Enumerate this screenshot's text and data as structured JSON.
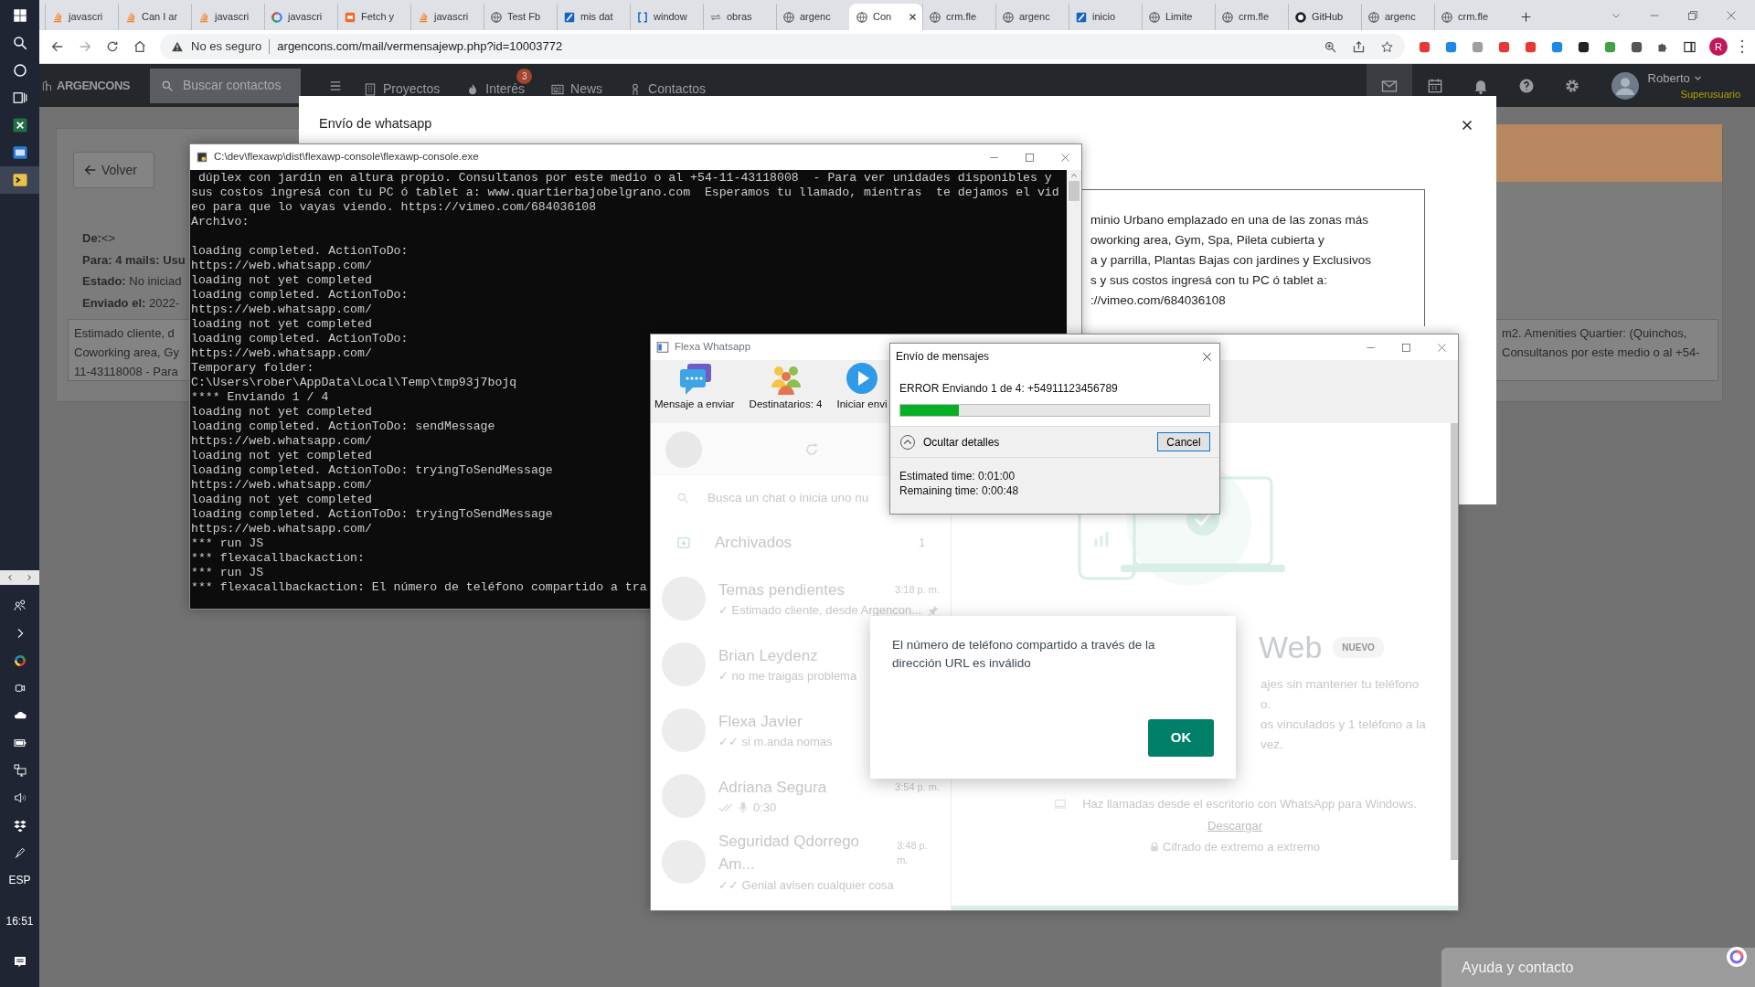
{
  "taskbar": {
    "apps": [
      {
        "kind": "sheet",
        "selected": false
      },
      {
        "kind": "app",
        "selected": false
      },
      {
        "kind": "terminal",
        "selected": true
      }
    ],
    "language": "ESP",
    "clock": "16:51"
  },
  "browser": {
    "tabs": [
      {
        "kind": "stack",
        "label": "javascri",
        "selected": false
      },
      {
        "kind": "stack",
        "label": "Can I ar",
        "selected": false
      },
      {
        "kind": "stack",
        "label": "javascri",
        "selected": false
      },
      {
        "kind": "ring",
        "label": "javascri",
        "selected": false
      },
      {
        "kind": "square",
        "label": "Fetch y",
        "selected": false
      },
      {
        "kind": "stack",
        "label": "javascri",
        "selected": false
      },
      {
        "kind": "globe",
        "label": "Test Fb",
        "selected": false
      },
      {
        "kind": "tile",
        "label": "mis dat",
        "selected": false
      },
      {
        "kind": "bracket",
        "label": "window",
        "selected": false
      },
      {
        "kind": "arrows",
        "label": "obras",
        "selected": false
      },
      {
        "kind": "globe",
        "label": "argenc",
        "selected": false
      },
      {
        "kind": "globe",
        "label": "Con",
        "selected": true
      },
      {
        "kind": "globe",
        "label": "crm.fle",
        "selected": false
      },
      {
        "kind": "globe",
        "label": "argenc",
        "selected": false
      },
      {
        "kind": "tile",
        "label": "inicio",
        "selected": false
      },
      {
        "kind": "globe",
        "label": "Limite",
        "selected": false
      },
      {
        "kind": "globe",
        "label": "crm.fle",
        "selected": false
      },
      {
        "kind": "cat",
        "label": "GitHub",
        "selected": false
      },
      {
        "kind": "globe",
        "label": "argenc",
        "selected": false
      },
      {
        "kind": "globe",
        "label": "crm.fle",
        "selected": false
      }
    ],
    "address": {
      "security": "No es seguro",
      "url": "argencons.com/mail/vermensajewp.php?id=10003772"
    },
    "profile": "R"
  },
  "site": {
    "logo": "ARGENCONS",
    "search_placeholder": "Buscar contactos",
    "nav": [
      {
        "kind": "building",
        "label": "Proyectos"
      },
      {
        "kind": "flame",
        "label": "Interés",
        "badge": "3"
      },
      {
        "kind": "news",
        "label": "News"
      },
      {
        "kind": "person",
        "label": "Contactos"
      }
    ],
    "tools": [
      {
        "kind": "mail",
        "selected": true
      },
      {
        "kind": "calendar",
        "selected": false
      },
      {
        "kind": "bell",
        "selected": false
      },
      {
        "kind": "help",
        "selected": false
      },
      {
        "kind": "gear",
        "selected": false
      }
    ],
    "user": {
      "name": "Roberto",
      "role": "Superusuario"
    }
  },
  "page": {
    "back_button": "Volver",
    "fields": [
      {
        "label": "De:",
        "value": "<>"
      },
      {
        "label": "Para: 4 mails: Usu"
      },
      {
        "label": "Estado:",
        "value": "No iniciad"
      },
      {
        "label": "Enviado el:",
        "value": "2022-"
      }
    ],
    "message": {
      "left": [
        "Estimado cliente, d",
        "Coworking area, Gy",
        "11-43118008 - Para"
      ],
      "right": [
        "m2. Amenities Quartier: (Quinchos,",
        "Consultanos por este medio o al +54-"
      ]
    }
  },
  "modal": {
    "title": "Envío de whatsapp",
    "message": [
      "minio Urbano emplazado en una de las zonas más",
      "oworking area, Gym, Spa, Pileta cubierta y",
      "a y parrilla, Plantas Bajas con jardines y Exclusivos",
      "s y sus costos ingresá con tu PC ó tablet a:",
      "://vimeo.com/684036108"
    ]
  },
  "console": {
    "title": "C:\\dev\\flexawp\\dist\\flexawp-console\\flexawp-console.exe",
    "blocks": [
      [
        " dúplex con jardín en altura propio. Consultanos por este medio o al +54-11-43118008  - Para ver unidades disponibles y",
        "sus costos ingresá con tu PC ó tablet a: www.quartierbajobelgrano.com  Esperamos tu llamado, mientras  te dejamos el vid",
        "eo para que lo vayas viendo. https://vimeo.com/684036108",
        "Archivo:"
      ],
      [
        "loading completed. ActionToDo:",
        "https://web.whatsapp.com/",
        "loading not yet completed",
        "loading completed. ActionToDo:",
        "https://web.whatsapp.com/",
        "loading not yet completed",
        "loading completed. ActionToDo:",
        "https://web.whatsapp.com/",
        "Temporary folder:",
        "C:\\Users\\rober\\AppData\\Local\\Temp\\tmp93j7bojq",
        "**** Enviando 1 / 4",
        "loading not yet completed",
        "loading completed. ActionToDo: sendMessage",
        "https://web.whatsapp.com/",
        "loading not yet completed",
        "loading completed. ActionToDo: tryingToSendMessage",
        "https://web.whatsapp.com/",
        "loading not yet completed",
        "loading completed. ActionToDo: tryingToSendMessage",
        "https://web.whatsapp.com/",
        "*** run JS",
        "*** flexacallbackaction:",
        "*** run JS",
        "*** flexacallbackaction: El número de teléfono compartido a tra"
      ]
    ]
  },
  "flexa": {
    "title": "Flexa Whatsapp",
    "toolbar": [
      {
        "kind": "message",
        "label": "Mensaje a enviar"
      },
      {
        "kind": "people",
        "label": "Destinatarios: 4"
      },
      {
        "kind": "play",
        "label": "Iniciar envi"
      }
    ],
    "webview": {
      "search_placeholder": "Busca un chat o inicia uno nu",
      "archived": {
        "label": "Archivados",
        "count": "1"
      },
      "chats": [
        {
          "kind": "text",
          "name": "Temas pendientes",
          "time": "3:18 p. m.",
          "preview": "✓ Estimado cliente, desde Argencon...",
          "pinned": true
        },
        {
          "kind": "text",
          "name": "Brian Leydenz",
          "preview": "✓ no me traigas problema",
          "pinned": false
        },
        {
          "kind": "text",
          "name": "Flexa Javier",
          "preview": "✓✓ si m.anda nomas",
          "pinned": false
        },
        {
          "kind": "voice",
          "name": "Adriana Segura",
          "time": "3:54 p. m.",
          "preview": "0:30",
          "pinned": false
        },
        {
          "kind": "text",
          "name": "Seguridad Qdorrego Am...",
          "time": "3:48 p. m.",
          "preview": "✓✓ Genial avisen cualquier cosa",
          "pinned": false
        }
      ],
      "intro": {
        "title": "Web",
        "badge": "NUEVO",
        "lines": [
          "ajes sin mantener tu teléfono",
          "o.",
          "os vinculados y 1 teléfono a la",
          "vez."
        ],
        "call_text": "Haz llamadas desde el escritorio con WhatsApp para Windows.",
        "link": "Descargar",
        "encryption": "Cifrado de extremo a extremo"
      }
    }
  },
  "progress": {
    "title": "Envío de mensajes",
    "status": "ERROR Enviando 1 de 4: +54911123456789",
    "level": 0.19,
    "details_toggle": "Ocultar detalles",
    "expanded": true,
    "cancel": "Cancel",
    "estimated": "Estimated time: 0:01:00",
    "remaining": "Remaining time: 0:00:48"
  },
  "alert": {
    "message": "El número de teléfono compartido a través de la dirección URL es inválido",
    "ok": "OK"
  },
  "help": {
    "label": "Ayuda y contacto"
  }
}
